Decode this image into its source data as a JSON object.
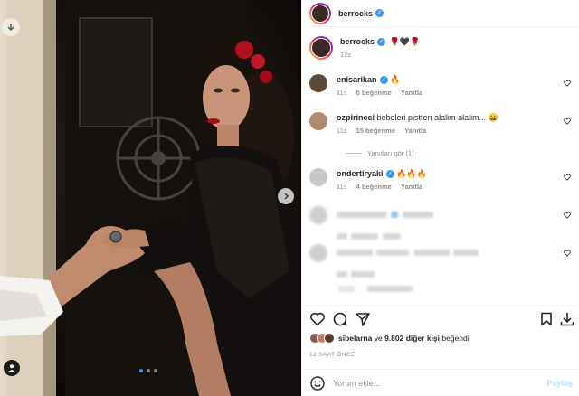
{
  "post": {
    "author": "berrocks",
    "author_verified": true,
    "media": {
      "carousel_dots": 3,
      "active_dot": 0
    }
  },
  "caption": {
    "username": "berrocks",
    "emojis": "🌹🖤🌹",
    "age": "12s"
  },
  "comments": [
    {
      "username": "enisarikan",
      "verified": true,
      "text": "🔥",
      "age": "11s",
      "likes": "5 beğenme",
      "reply": "Yanıtla",
      "avatar_color": "#5a4a3a"
    },
    {
      "username": "ozpirincci",
      "verified": false,
      "text": "bebeleri pistten alalim alalim... 😄",
      "age": "11s",
      "likes": "15 beğenme",
      "reply": "Yanıtla",
      "avatar_color": "#b08a70"
    },
    {
      "username": "ondertiryaki",
      "verified": true,
      "text": "🔥🔥🔥",
      "age": "11s",
      "likes": "4 beğenme",
      "reply": "Yanıtla",
      "avatar_color": "#c8c8c8"
    }
  ],
  "view_replies": "Yanıtları gör (1)",
  "likes": {
    "first_user": "sibelarna",
    "connector": "ve",
    "others": "9.802 diğer kişi",
    "suffix": "beğendi"
  },
  "timestamp": "12 SAAT ÖNCE",
  "add_comment": {
    "placeholder": "Yorum ekle...",
    "post_label": "Paylaş"
  },
  "colors": {
    "accent": "#3897f0",
    "post_disabled": "#b2dffc",
    "muted": "#8e8e8e"
  }
}
